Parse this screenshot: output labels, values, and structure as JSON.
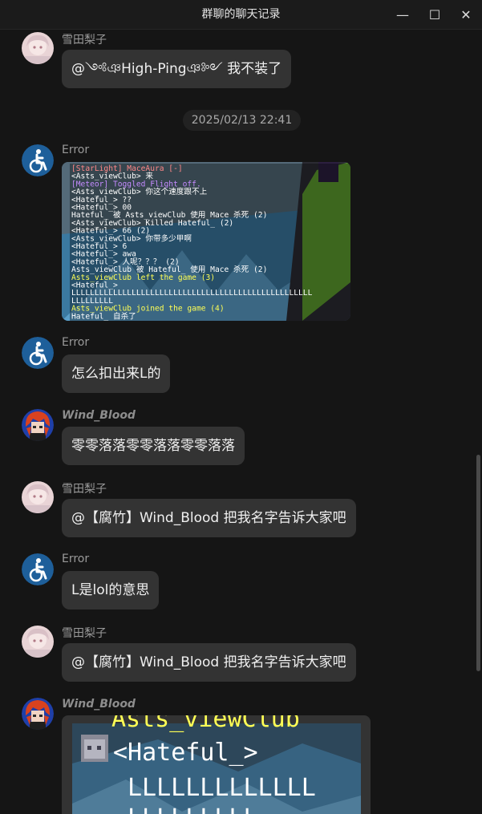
{
  "window": {
    "title": "群聊的聊天记录",
    "minimize_glyph": "—",
    "maximize_glyph": "☐",
    "close_glyph": "✕"
  },
  "messages": [
    {
      "sender": "雪田梨子",
      "text": "@༺ঞHigh-Pingঞ༻ 我不装了"
    },
    {
      "timestamp": "2025/02/13 22:41"
    },
    {
      "sender": "Error",
      "image": "game-chat-screenshot"
    },
    {
      "sender": "Error",
      "text": "怎么扣出来L的"
    },
    {
      "sender": "Wind_Blood",
      "text": "零零落落零零落落零零落落"
    },
    {
      "sender": "雪田梨子",
      "text": "@【腐竹】Wind_Blood 把我名字告诉大家吧"
    },
    {
      "sender": "Error",
      "text": "L是lol的意思"
    },
    {
      "sender": "雪田梨子",
      "text": "@【腐竹】Wind_Blood 把我名字告诉大家吧"
    },
    {
      "sender": "Wind_Blood",
      "image": "game-chat-zoomed-screenshot"
    }
  ],
  "game_chat": [
    "[StarLight] MaceAura [-]",
    "<Asts_viewClub> 来",
    "[Meteor] Toggled Flight off.",
    "<Asts_viewClub> 你这个速度跟不上",
    "<Hateful_> ??",
    "<Hateful_> 00",
    "Hateful_ 被 Asts_viewClub 使用 Mace 杀死 (2)",
    "<Asts_viewClub> Killed Hateful_ (2)",
    "<Hateful_> 66 (2)",
    "<Asts_viewClub> 你带多少甲啊",
    "<Hateful_> 6",
    "<Hateful_> awa",
    "<Hateful_> 人呢？？？ (2)",
    "Asts_viewClub 被 Hateful_ 使用 Mace 杀死 (2)",
    "Asts_viewClub left the game (3)",
    "<Hateful_>",
    "LLLLLLLLLLLLLLLLLLLLLLLLLLLLLLLLLLLLLLLLLLLLLLLLLLLL",
    "LLLLLLLLL",
    "Asts_viewClub joined the game (4)",
    "Hateful_ 自杀了"
  ],
  "zoomed_chat": {
    "header": "Asts_viewClub",
    "name": "<Hateful_>",
    "line1": "LLLLLLLLLLLLL",
    "line2": "LLLLLLLLL"
  },
  "colors": {
    "background": "#151515",
    "bubble": "#333333",
    "accent_error_avatar": "#1e5f9a"
  },
  "icons": {
    "error_avatar": "wheelchair-icon",
    "snow_avatar": "anime-girl-avatar",
    "wind_avatar": "red-hair-character-avatar"
  }
}
